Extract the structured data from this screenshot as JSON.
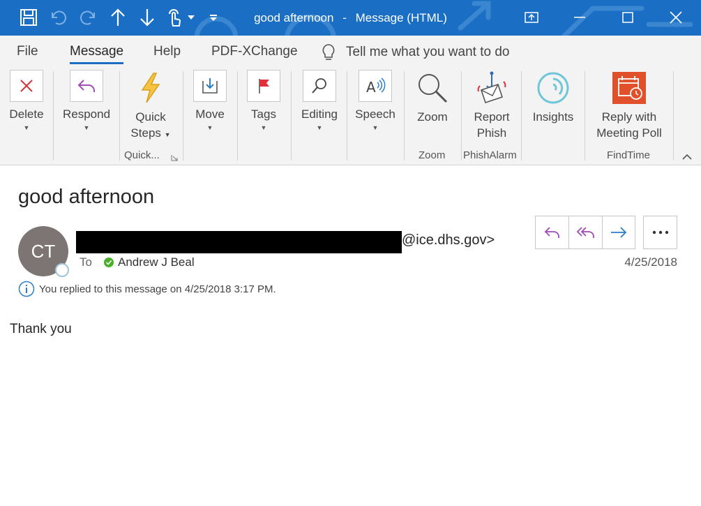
{
  "window": {
    "title_subject": "good afternoon",
    "title_separator": "-",
    "title_type": "Message (HTML)"
  },
  "quick_access": {
    "icons": [
      "save-icon",
      "undo-icon",
      "redo-icon",
      "previous-item-icon",
      "next-item-icon",
      "touch-mode-icon",
      "customize-dropdown-icon"
    ]
  },
  "tabs": [
    {
      "label": "File",
      "active": false
    },
    {
      "label": "Message",
      "active": true
    },
    {
      "label": "Help",
      "active": false
    },
    {
      "label": "PDF-XChange",
      "active": false
    }
  ],
  "tell_me": {
    "label": "Tell me what you want to do"
  },
  "ribbon": {
    "delete": {
      "label": "Delete"
    },
    "respond": {
      "label": "Respond"
    },
    "quick_steps": {
      "line1": "Quick",
      "line2": "Steps",
      "group_label": "Quick..."
    },
    "move": {
      "label": "Move"
    },
    "tags": {
      "label": "Tags"
    },
    "editing": {
      "label": "Editing"
    },
    "speech": {
      "label": "Speech"
    },
    "zoom": {
      "label": "Zoom",
      "group_label": "Zoom"
    },
    "report_phish": {
      "line1": "Report",
      "line2": "Phish",
      "group_label": "PhishAlarm"
    },
    "insights": {
      "label": "Insights"
    },
    "meeting_poll": {
      "line1": "Reply with",
      "line2": "Meeting Poll",
      "group_label": "FindTime"
    }
  },
  "message": {
    "subject": "good afternoon",
    "avatar_initials": "CT",
    "sender_domain": "@ice.dhs.gov>",
    "to_label": "To",
    "recipient": "Andrew J Beal",
    "date": "4/25/2018",
    "info": "You replied to this message on 4/25/2018 3:17 PM.",
    "body": "Thank you"
  },
  "colors": {
    "titlebar": "#1a6fc4",
    "ribbon_bg": "#f3f3f3",
    "avatar": "#7c7574",
    "reply_purple": "#a24ab8",
    "forward_blue": "#2a7fc9",
    "delete_red": "#d13438"
  }
}
